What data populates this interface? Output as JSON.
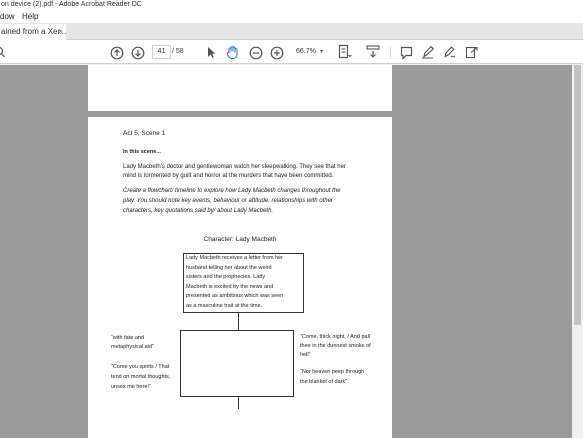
{
  "window": {
    "title": "on device (2).pdf - Adobe Acrobat Reader DC"
  },
  "menu": {
    "items": [
      "dow",
      "Help"
    ]
  },
  "tab": {
    "label": "ained from a Xer...",
    "close": "×"
  },
  "toolbar": {
    "page_current": "41",
    "page_total": "/ 58",
    "zoom": "66.7%",
    "zoom_arrow": "▾",
    "icons": [
      "search-icon",
      "prev-page-icon",
      "next-page-icon",
      "select-arrow-icon",
      "hand-tool-icon",
      "zoom-out-icon",
      "zoom-in-icon",
      "fit-page-icon",
      "scroll-mode-icon",
      "comment-icon",
      "highlight-pen-icon",
      "fill-sign-icon",
      "share-icon"
    ]
  },
  "document": {
    "scene": "Act 5, Scene 1",
    "in_this_scene": "In this scene...",
    "summary": [
      "Lady Macbeth’s doctor and gentlewoman watch her sleepwalking. They see that her",
      "mind is tormented by guilt and horror at the murders that have been committed."
    ],
    "task": [
      "Create a flowchart/ timeline to explore how Lady Macbeth changes throughout the",
      "play. You should note key events, behaviour or attitude, relationships with other",
      "characters, key quotations said by/ about Lady Macbeth."
    ],
    "character_title": "Character: Lady Macbeth",
    "box1_text": [
      "Lady Macbeth receives a letter from her",
      "husband telling her about the weird",
      "sisters and the prophecies.  Lady",
      "Macbeth is excited by the news and",
      "presented as ambitious which was seen",
      "as a masculine trait at the time."
    ],
    "left_quotes": [
      [
        "“with fate and",
        "metaphysical aid”"
      ],
      [
        "“Come you spirits / That",
        "tend on mortal thoughts,",
        "unsex me here!”"
      ]
    ],
    "right_quotes": [
      [
        "“Come, thick night, / And pall",
        "thee in the dunnest smoke of",
        "hell”"
      ],
      [
        "“Nor heaven peep through",
        "the blanket of dark”"
      ]
    ]
  },
  "colors": {
    "viewer_bg": "#9b9b9b",
    "page_bg": "#ffffff",
    "toolbar_bg": "#ffffff"
  }
}
